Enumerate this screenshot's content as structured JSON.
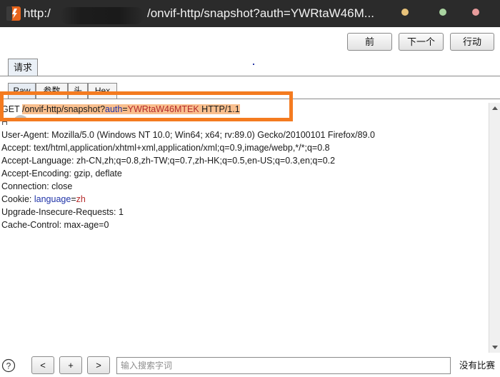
{
  "window": {
    "title_left": "http:/",
    "title_right": "/onvif-http/snapshot?auth=YWRtaW46M..."
  },
  "toolbar": {
    "prev_label": "前",
    "next_label": "下一个",
    "action_label": "行动"
  },
  "tabs": {
    "main": "请求",
    "sub": [
      "Raw",
      "参数",
      "头",
      "Hex"
    ]
  },
  "request": {
    "method": "GET",
    "path": "/onvif-http/snapshot?",
    "param_name": "auth",
    "param_sep": "=",
    "param_value": "YWRtaW46MTEK",
    "version": "HTTP/1.1",
    "host_partial": "H",
    "headers": [
      {
        "text": "User-Agent: Mozilla/5.0 (Windows NT 10.0; Win64; x64; rv:89.0) Gecko/20100101 Firefox/89.0"
      },
      {
        "text": "Accept: text/html,application/xhtml+xml,application/xml;q=0.9,image/webp,*/*;q=0.8"
      },
      {
        "text": "Accept-Language: zh-CN,zh;q=0.8,zh-TW;q=0.7,zh-HK;q=0.5,en-US;q=0.3,en;q=0.2"
      },
      {
        "text": "Accept-Encoding: gzip, deflate"
      },
      {
        "text": "Connection: close"
      }
    ],
    "cookie": {
      "label": "Cookie: ",
      "name": "language",
      "sep": "=",
      "value": "zh"
    },
    "headers_after": [
      {
        "text": "Upgrade-Insecure-Requests: 1"
      },
      {
        "text": "Cache-Control: max-age=0"
      }
    ]
  },
  "bottom": {
    "help": "?",
    "prev": "<",
    "add": "+",
    "next": ">",
    "search_placeholder": "输入搜索字词",
    "match_label": "没有比赛"
  },
  "colors": {
    "highlight_box": "#f47b20",
    "selection_bg": "#f9bf8e",
    "param_name": "#1f33a8",
    "param_value": "#b52a2a",
    "window_dots": [
      "#e8c27a",
      "#a9d3a0",
      "#e79b9b"
    ]
  }
}
